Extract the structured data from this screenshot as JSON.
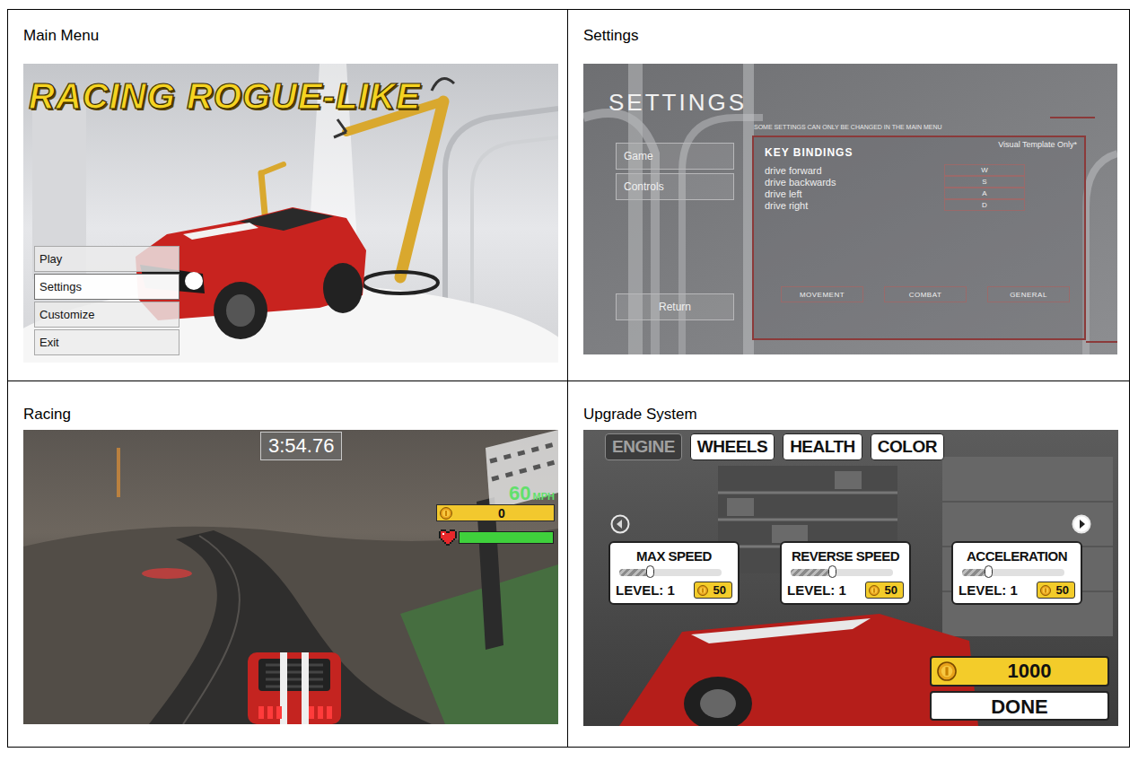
{
  "main_menu": {
    "caption": "Main Menu",
    "title": "RACING ROGUE-LIKE",
    "buttons": [
      {
        "label": "Play",
        "selected": false
      },
      {
        "label": "Settings",
        "selected": true
      },
      {
        "label": "Customize",
        "selected": false
      },
      {
        "label": "Exit",
        "selected": false
      }
    ]
  },
  "settings": {
    "caption": "Settings",
    "title": "SETTINGS",
    "notice": "SOME SETTINGS CAN ONLY BE CHANGED IN THE MAIN MENU",
    "side_items": [
      "Game",
      "Controls"
    ],
    "return_button": "Return",
    "panel": {
      "title": "KEY BINDINGS",
      "note": "Visual Template Only*",
      "bindings": [
        {
          "action": "drive forward",
          "key": "W"
        },
        {
          "action": "drive backwards",
          "key": "S"
        },
        {
          "action": "drive left",
          "key": "A"
        },
        {
          "action": "drive right",
          "key": "D"
        }
      ],
      "tabs": [
        "MOVEMENT",
        "COMBAT",
        "GENERAL"
      ]
    }
  },
  "racing": {
    "caption": "Racing",
    "timer": "3:54.76",
    "speed": "60",
    "speed_unit": "MPH",
    "coins": "0",
    "health": {
      "level": 1
    }
  },
  "upgrade": {
    "caption": "Upgrade System",
    "tabs": [
      {
        "label": "ENGINE",
        "selected": true
      },
      {
        "label": "WHEELS",
        "selected": false
      },
      {
        "label": "HEALTH",
        "selected": false
      },
      {
        "label": "COLOR",
        "selected": false
      }
    ],
    "stats": [
      {
        "name": "MAX SPEED",
        "level": 0.3,
        "level_text": "LEVEL: 1",
        "cost": "50"
      },
      {
        "name": "REVERSE SPEED",
        "level": 0.4,
        "level_text": "LEVEL: 1",
        "cost": "50"
      },
      {
        "name": "ACCELERATION",
        "level": 0.25,
        "level_text": "LEVEL: 1",
        "cost": "50"
      }
    ],
    "coins": "1000",
    "done_button": "DONE"
  }
}
